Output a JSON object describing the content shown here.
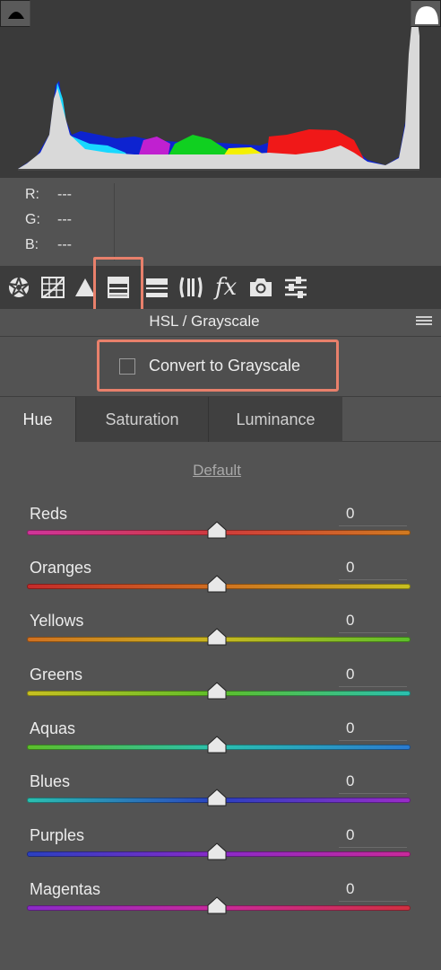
{
  "readout": [
    {
      "label": "R:",
      "value": "---"
    },
    {
      "label": "G:",
      "value": "---"
    },
    {
      "label": "B:",
      "value": "---"
    }
  ],
  "toolbar": {
    "icons": [
      "aperture-icon",
      "grid-icon",
      "triangle-icon",
      "hsl-grayscale-icon",
      "split-toning-icon",
      "lens-corrections-icon",
      "fx-icon",
      "camera-calibration-icon",
      "presets-sliders-icon"
    ],
    "fx_label": "fx",
    "active": "hsl-grayscale-icon"
  },
  "panel": {
    "title": "HSL / Grayscale",
    "convert_label": "Convert to Grayscale",
    "convert_checked": false,
    "highlight_color": "#e8806b"
  },
  "tabs": [
    {
      "label": "Hue",
      "active": true
    },
    {
      "label": "Saturation",
      "active": false
    },
    {
      "label": "Luminance",
      "active": false
    }
  ],
  "default_link": "Default",
  "sliders": [
    {
      "label": "Reds",
      "value": "0",
      "colors": [
        "#d0349a",
        "#d03b3b",
        "#d07a20"
      ]
    },
    {
      "label": "Oranges",
      "value": "0",
      "colors": [
        "#c42a2a",
        "#d07020",
        "#c8c020"
      ]
    },
    {
      "label": "Yellows",
      "value": "0",
      "colors": [
        "#d07020",
        "#c8b820",
        "#5cbf2a"
      ]
    },
    {
      "label": "Greens",
      "value": "0",
      "colors": [
        "#c8c020",
        "#5cbf2a",
        "#2ac0b0"
      ]
    },
    {
      "label": "Aquas",
      "value": "0",
      "colors": [
        "#5cbf2a",
        "#2ac0b0",
        "#2a7ad0"
      ]
    },
    {
      "label": "Blues",
      "value": "0",
      "colors": [
        "#2ac0b0",
        "#2a40c0",
        "#9a2ac8"
      ]
    },
    {
      "label": "Purples",
      "value": "0",
      "colors": [
        "#2a40c0",
        "#8a2ac8",
        "#c82a9a"
      ]
    },
    {
      "label": "Magentas",
      "value": "0",
      "colors": [
        "#8a2ac8",
        "#c82a9a",
        "#d03040"
      ]
    }
  ]
}
